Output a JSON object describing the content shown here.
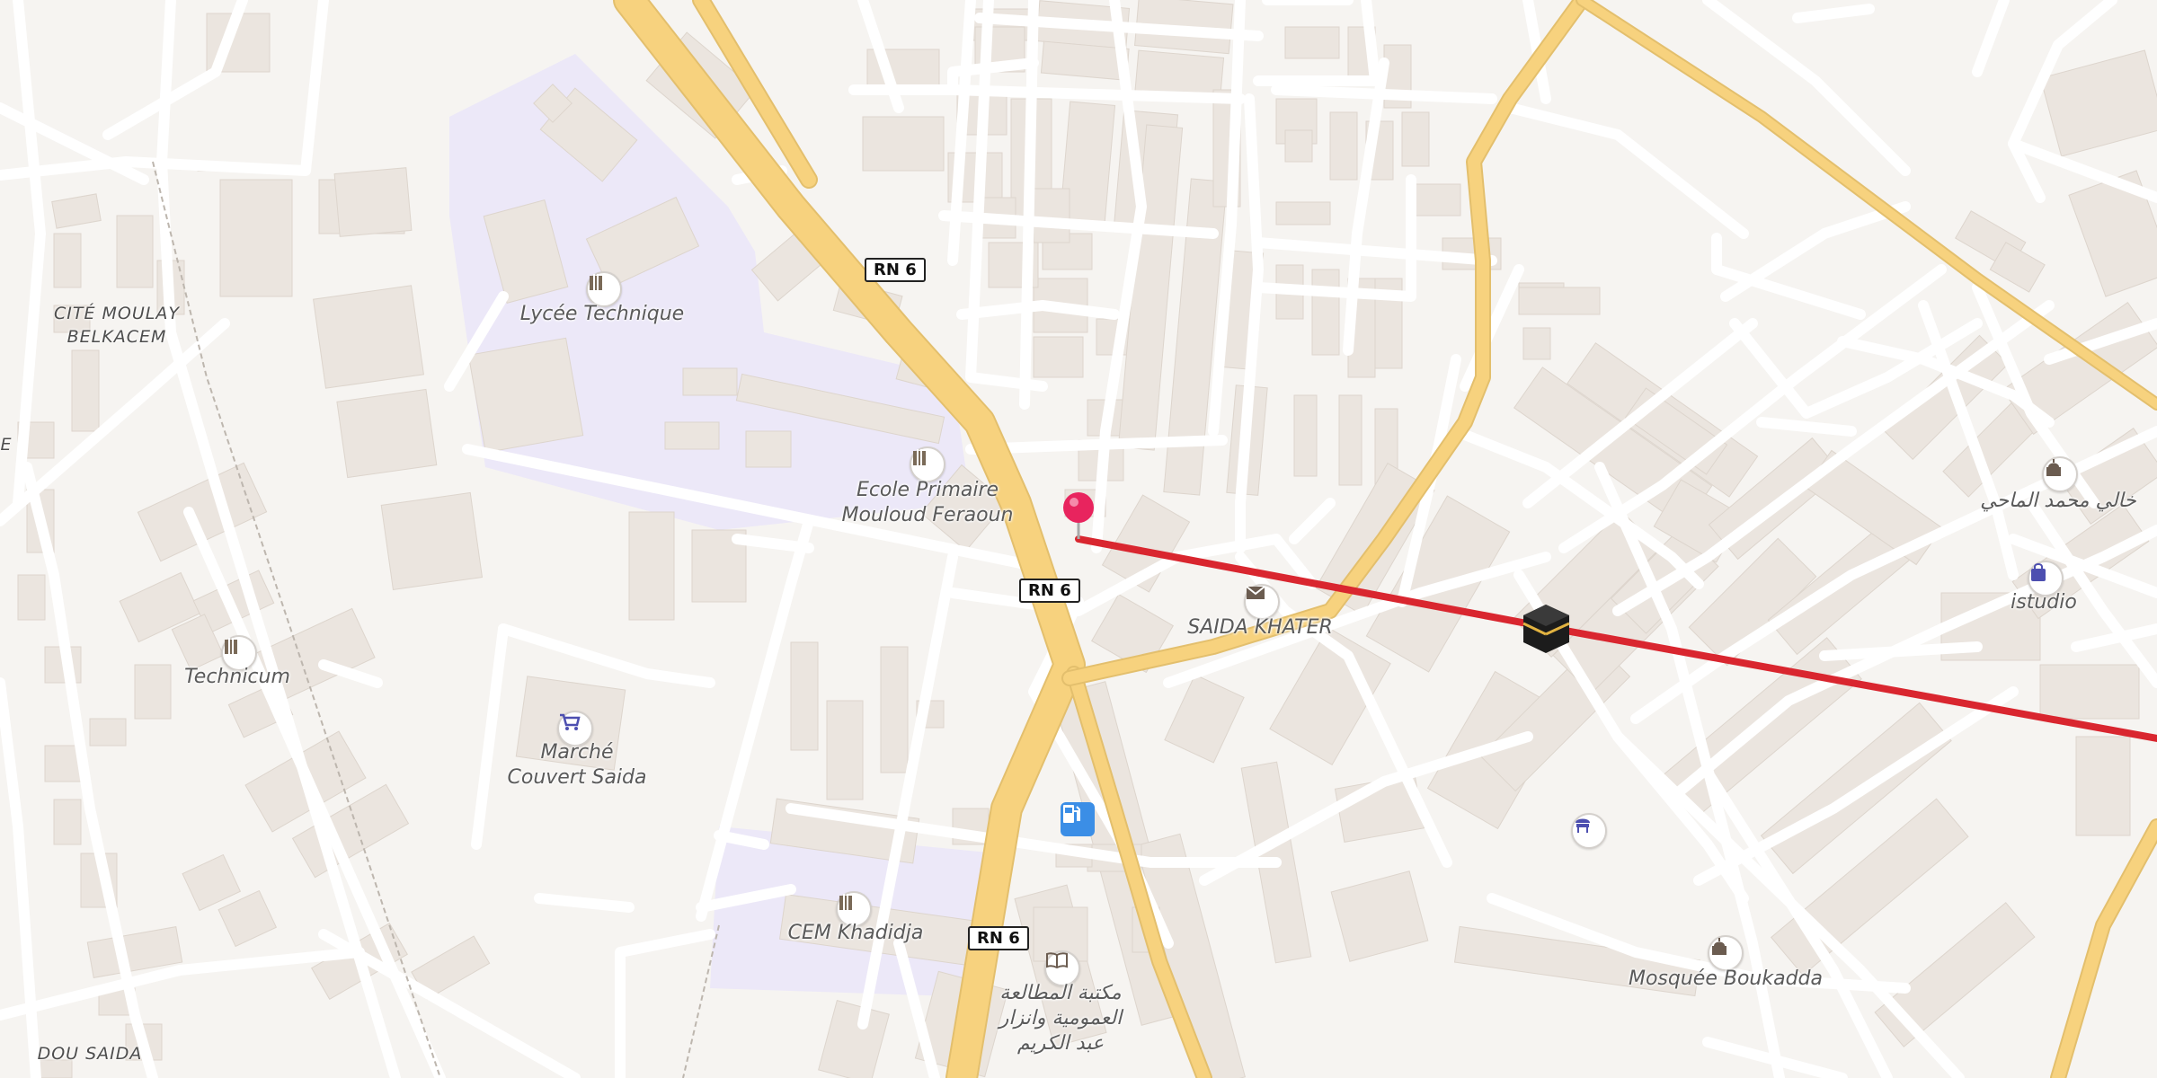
{
  "map": {
    "route_color": "#d9262f",
    "pin_color": "#e8245e",
    "major_road_color": "#f7d27e",
    "institution_color": "#ece8f8",
    "labels": {
      "lycee": "Lycée Technique",
      "ecole": "Ecole Primaire\nMouloud Feraoun",
      "saida_khater": "SAIDA KHATER",
      "technicum": "Technicum",
      "marche": "Marché\nCouvert Saida",
      "cem": "CEM Khadidja",
      "library": "مكتبة المطالعة\nالعمومية وانزار\nعبد الكريم",
      "mosquee": "Mosquée Boukadda",
      "istudio": "istudio",
      "arabic_shop": "خالي محمد الماحي",
      "cite": "CITÉ MOULAY\nBELKACEM",
      "dou_saida": "DOU SAIDA",
      "edge_e": "E"
    },
    "shields": [
      "RN 6",
      "RN 6",
      "RN 6"
    ],
    "icons": {
      "school": "school-icon",
      "post": "envelope-icon",
      "market": "cart-icon",
      "library": "book-icon",
      "mosque": "mosque-icon",
      "shop": "shopping-bag-icon",
      "fuel": "fuel-pump-icon",
      "kaaba": "kaaba-icon",
      "transit": "transit-icon",
      "pin": "map-pin-icon"
    }
  }
}
